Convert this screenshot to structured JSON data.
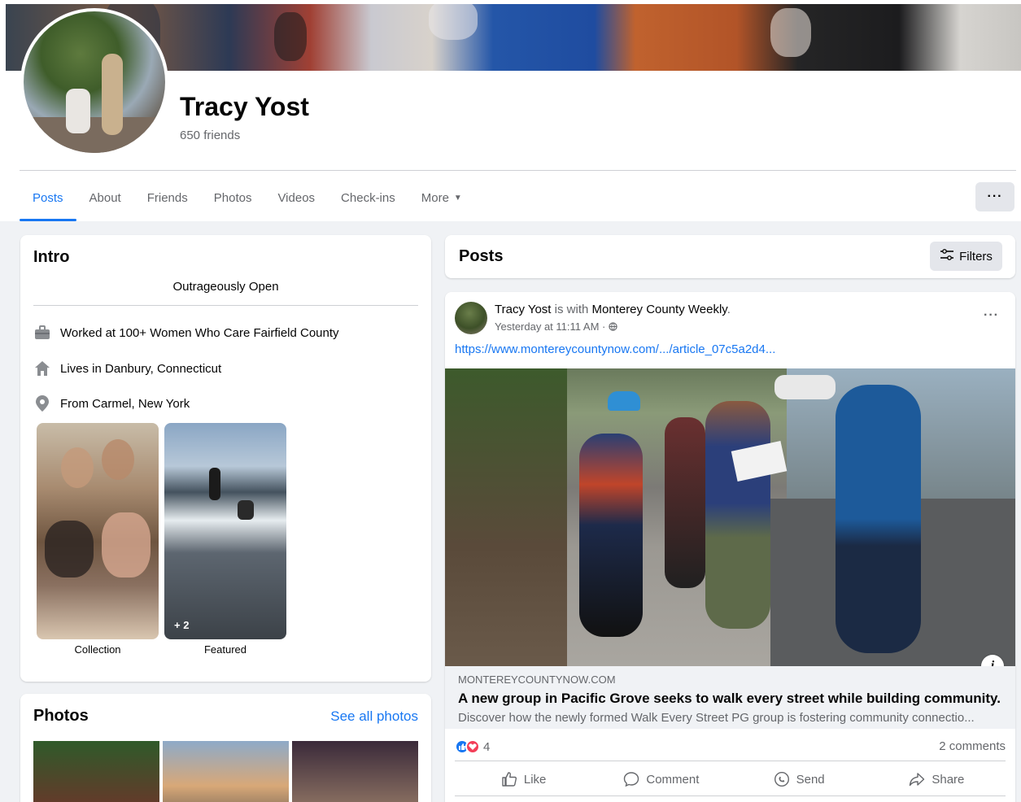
{
  "profile": {
    "name": "Tracy Yost",
    "friends": "650 friends"
  },
  "tabs": [
    {
      "label": "Posts",
      "active": true
    },
    {
      "label": "About"
    },
    {
      "label": "Friends"
    },
    {
      "label": "Photos"
    },
    {
      "label": "Videos"
    },
    {
      "label": "Check-ins"
    },
    {
      "label": "More"
    }
  ],
  "header_more": "···",
  "intro": {
    "title": "Intro",
    "bio": "Outrageously Open",
    "work": {
      "prefix": "Worked at ",
      "place": "100+ Women Who Care Fairfield County",
      "icon": "briefcase-icon"
    },
    "lives": {
      "prefix": "Lives in ",
      "place": "Danbury, Connecticut",
      "icon": "home-icon"
    },
    "from": {
      "prefix": "From ",
      "place": "Carmel, New York",
      "icon": "location-pin-icon"
    },
    "featured": [
      {
        "label": "Collection"
      },
      {
        "label": "Featured",
        "badge": "+ 2"
      }
    ]
  },
  "photos": {
    "title": "Photos",
    "see_all": "See all photos"
  },
  "posts": {
    "title": "Posts",
    "filters": "Filters"
  },
  "post": {
    "author": "Tracy Yost",
    "with_text": " is with ",
    "with_who": "Monterey County Weekly",
    "period": ".",
    "time": "Yesterday at 11:11 AM · ",
    "link": "https://www.montereycountynow.com/.../article_07c5a2d4...",
    "preview": {
      "domain": "MONTEREYCOUNTYNOW.COM",
      "title": "A new group in Pacific Grove seeks to walk every street while building community.",
      "description": "Discover how the newly formed Walk Every Street PG group is fostering community connectio..."
    },
    "reaction_count": "4",
    "comments": "2 comments",
    "actions": {
      "like": "Like",
      "comment": "Comment",
      "send": "Send",
      "share": "Share"
    }
  },
  "colors": {
    "accent": "#1877f2",
    "muted": "#65676b",
    "background": "#f0f2f5"
  }
}
